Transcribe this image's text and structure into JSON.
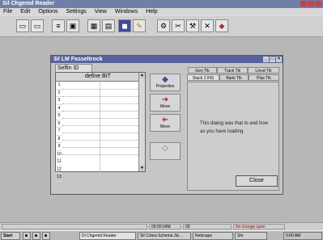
{
  "app": {
    "title": "Sil Chgemd Reader",
    "menu": [
      "File",
      "Edit",
      "Options",
      "Settings",
      "View",
      "Windows",
      "Help"
    ]
  },
  "toolbar": {
    "icons": [
      "open-icon",
      "save-icon",
      "network-icon",
      "window-icon",
      "table-icon",
      "chart-icon",
      "signal-icon",
      "print-icon",
      "tool-icon",
      "copy-icon",
      "settings-icon",
      "close-icon",
      "book-icon"
    ]
  },
  "child": {
    "title": "3il LM Fasseltrock",
    "left_tab": "Selfin ID",
    "table_header": "define BIT",
    "row_numbers": [
      "1",
      "2",
      "3",
      "4",
      "5",
      "6",
      "7",
      "8",
      "9",
      "10",
      "11",
      "12",
      "13"
    ],
    "mid_buttons": [
      {
        "label": "Properties",
        "icon": "◆"
      },
      {
        "label": "Move",
        "icon": "➜"
      },
      {
        "label": "Move",
        "icon": "➜"
      },
      {
        "label": "",
        "icon": "◇"
      }
    ],
    "right_tabs_row1": [
      "Gen Tlk",
      "Track Tlk",
      "Lmvd Tlk"
    ],
    "right_tabs_row2": [
      "Stack 2 INS",
      "Bank Tlk",
      "Plas Tlk"
    ],
    "description": "This dialog was that to and how as you have loading.",
    "close_label": "Close"
  },
  "status": {
    "sections": [
      "",
      "00:00:04M",
      "00",
      "No change open"
    ]
  },
  "taskbar": {
    "start_label": "Start",
    "items": [
      "Di Chgemd Reader",
      "Sil Cobra-Schema 3d...",
      "Netscape",
      "Shr"
    ],
    "clock": "5:00 AM"
  },
  "colors": {
    "titlebar": "#6e7fa8",
    "child_title": "#56639a",
    "workspace": "#b7b7b7"
  }
}
